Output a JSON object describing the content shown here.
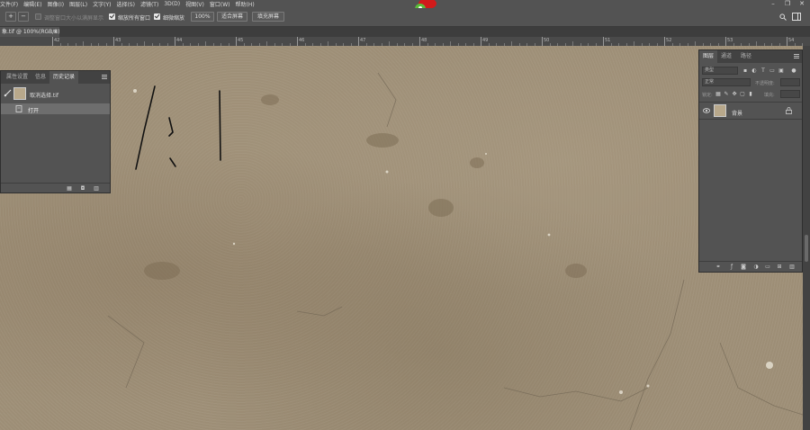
{
  "menu": [
    "文件(F)",
    "编辑(E)",
    "图像(I)",
    "图层(L)",
    "文字(Y)",
    "选择(S)",
    "滤镜(T)",
    "3D(D)",
    "视图(V)",
    "窗口(W)",
    "帮助(H)"
  ],
  "window_controls": {
    "minimize": "–",
    "restore": "❐",
    "close": "✕"
  },
  "options": {
    "resize_windows_label": "调整窗口大小以满屏显示",
    "zoom_all_windows_label": "缩放所有窗口",
    "scrubby_zoom_label": "细微缩放",
    "zoom_percent": "100%",
    "fit_screen": "适合屏幕",
    "fill_screen": "填充屏幕"
  },
  "document_tab": {
    "title": "象.tif @ 100%(RGB/8)",
    "close": "×"
  },
  "ruler_labels": [
    "42",
    "43",
    "44",
    "45",
    "46",
    "47",
    "48",
    "49",
    "50",
    "51",
    "52",
    "53",
    "54"
  ],
  "history_panel": {
    "tabs": [
      "属性设置",
      "信息",
      "历史记录"
    ],
    "snapshot_name": "取消选择.tif",
    "steps": [
      {
        "label": "打开"
      }
    ]
  },
  "layers_panel": {
    "tabs": [
      "图层",
      "通道",
      "路径"
    ],
    "kind_placeholder": "类型",
    "blend_mode": "正常",
    "opacity_label": "不透明度:",
    "lock_label": "锁定:",
    "fill_label": "填充:",
    "layers": [
      {
        "name": "背景",
        "visible": true,
        "locked": true
      }
    ]
  },
  "colors": {
    "ui_bg": "#535353",
    "panel_dark": "#424242",
    "marble": "#9d8e76"
  }
}
